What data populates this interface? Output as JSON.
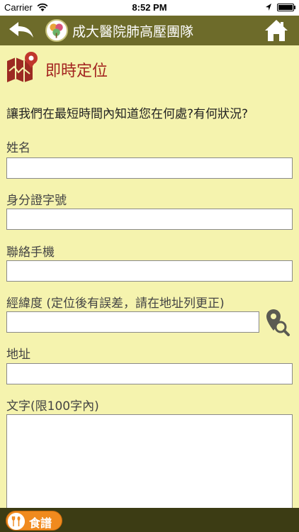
{
  "status_bar": {
    "carrier": "Carrier",
    "time": "8:52 PM"
  },
  "nav": {
    "title": "成大醫院肺高壓團隊",
    "back_icon": "back-arrow-icon",
    "home_icon": "home-icon"
  },
  "section": {
    "title": "即時定位",
    "icon": "map-pin-icon"
  },
  "prompt": "讓我們在最短時間內知道您在何處?有何狀況?",
  "form": {
    "name_label": "姓名",
    "name_value": "",
    "id_label": "身分證字號",
    "id_value": "",
    "phone_label": "聯絡手機",
    "phone_value": "",
    "coords_label": "經緯度 (定位後有誤差，請在地址列更正)",
    "coords_value": "",
    "address_label": "地址",
    "address_value": "",
    "text_label": "文字(限100字內)",
    "text_value": ""
  },
  "bottom": {
    "menu_label": "食譜"
  },
  "colors": {
    "background": "#f5f3ae",
    "nav": "#6d6b2a",
    "accent_red": "#a3231f",
    "menu_orange": "#f08a1e",
    "bottom_bar": "#3c3c14"
  }
}
